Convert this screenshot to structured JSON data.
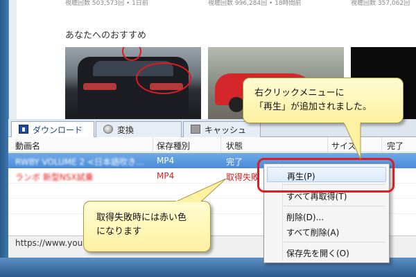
{
  "browser": {
    "view_counts": [
      "視聴回数 503,573回 • 1日前",
      "視聴回数 996,284回 • 18時間前",
      "視聴回数 357,062回"
    ],
    "recommend_title": "あなたへのおすすめ"
  },
  "tabs": [
    {
      "label": "ダウンロード",
      "icon": "download-icon"
    },
    {
      "label": "変換",
      "icon": "convert-icon"
    },
    {
      "label": "キャッシュ",
      "icon": "cache-icon"
    }
  ],
  "table": {
    "columns": [
      "動画名",
      "保存種別",
      "状態",
      "サイズ",
      "完了"
    ],
    "rows": [
      {
        "name": "RWBY VOLUME 2 <日本語吹き…",
        "type": "MP4",
        "state": "完了"
      },
      {
        "name": "ランボ 新型NSX試乗",
        "type": "MP4",
        "state": "取得失敗"
      }
    ]
  },
  "status_bar": {
    "url": "https://www.you"
  },
  "context_menu": {
    "items": [
      "再生(P)",
      "すべて再取得(T)",
      "削除(D)...",
      "すべて削除(A)",
      "保存先を開く(O)"
    ]
  },
  "callouts": {
    "menu_note": [
      "右クリックメニューに",
      "「再生」が追加されました。"
    ],
    "fail_note": [
      "取得失敗時には赤い色",
      "になります"
    ]
  },
  "colors": {
    "highlight_red": "#e11b22",
    "selection_blue": "#4a8cd8",
    "callout_yellow": "#fff4b0",
    "error_text": "#e02020"
  }
}
